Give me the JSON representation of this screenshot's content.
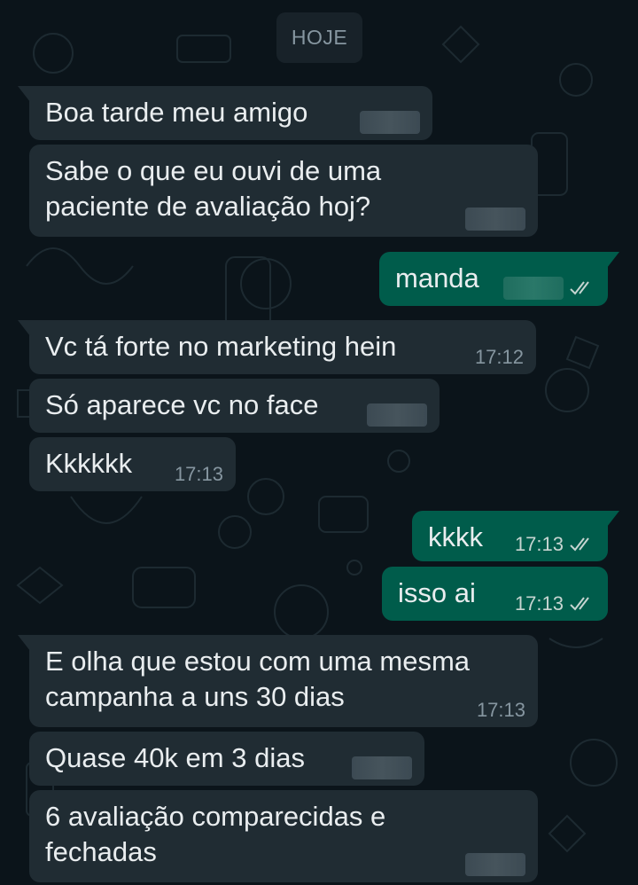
{
  "date_separator": "HOJE",
  "colors": {
    "background": "#0b141a",
    "incoming_bubble": "#202c33",
    "outgoing_bubble": "#005c4b",
    "meta_text": "#8696a0"
  },
  "messages": [
    {
      "direction": "in",
      "text": "Boa tarde meu amigo",
      "time": null
    },
    {
      "direction": "in",
      "text": "Sabe o que eu ouvi de uma\npaciente de avaliação hoj?",
      "time": null
    },
    {
      "direction": "out",
      "text": "manda",
      "time": null,
      "status": "double-check-icon"
    },
    {
      "direction": "in",
      "text": "Vc tá forte no marketing hein",
      "time": "17:12"
    },
    {
      "direction": "in",
      "text": "Só aparece vc no face",
      "time": null
    },
    {
      "direction": "in",
      "text": "Kkkkkk",
      "time": "17:13"
    },
    {
      "direction": "out",
      "text": "kkkk",
      "time": "17:13",
      "status": "double-check-icon"
    },
    {
      "direction": "out",
      "text": "isso ai",
      "time": "17:13",
      "status": "double-check-icon"
    },
    {
      "direction": "in",
      "text": "E olha que estou com uma mesma\ncampanha a uns 30 dias",
      "time": "17:13"
    },
    {
      "direction": "in",
      "text": "Quase 40k em 3 dias",
      "time": null
    },
    {
      "direction": "in",
      "text": "6 avaliação comparecidas e\nfechadas",
      "time": null
    }
  ]
}
